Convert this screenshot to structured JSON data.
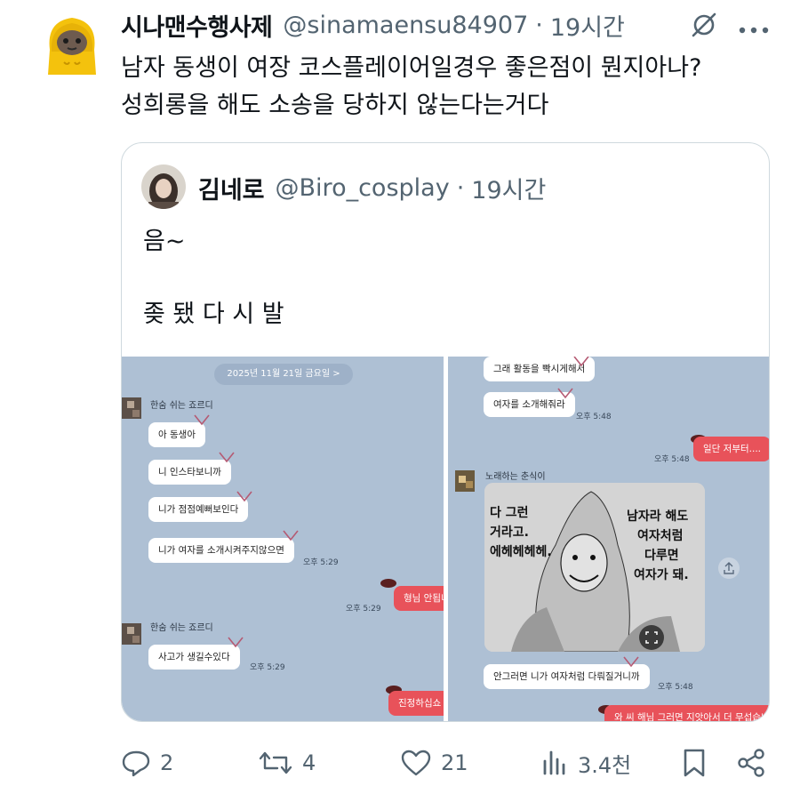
{
  "tweet": {
    "author_name": "시나맨수행사제",
    "author_handle": "@sinamaensu84907",
    "separator": "·",
    "time": "19시간",
    "text_line1": "남자 동생이 여장 코스플레이어일경우 좋은점이 뭔지아나?",
    "text_line2": "성희롱을 해도 소송을 당하지 않는다는거다"
  },
  "quote": {
    "author_name": "김네로",
    "author_handle": "@Biro_cosplay",
    "separator": "·",
    "time": "19시간",
    "text_line1": "음~",
    "text_line2": "좆 됐 다 시 발"
  },
  "chat_left": {
    "date": "2025년 11월 21일 금요일 >",
    "sender1": "한숨 쉬는 죠르디",
    "msgs1": [
      "아 동생아",
      "니 인스타보니까",
      "니가 점점예뻐보인다",
      "니가 여자를 소개시켜주지않으면"
    ],
    "time1": "오후 5:29",
    "reply1": "형님 안됩니다",
    "time2": "오후 5:29",
    "sender2": "한숨 쉬는 죠르디",
    "msg2": "사고가 생길수있다",
    "time3": "오후 5:29",
    "reply2": "진정하십쇼"
  },
  "chat_right": {
    "msg_top": "그래 활동을 빡시게해서",
    "msg2": "여자를 소개해줘라",
    "time1": "오후 5:48",
    "reply1": "일단 저부터....",
    "time2": "오후 5:48",
    "sender": "노래하는 춘식이",
    "comic_left_1": "다 그런",
    "comic_left_2": "거라고.",
    "comic_left_3": "에헤헤헤헤.",
    "comic_right_1": "남자라 해도",
    "comic_right_2": "여자처럼",
    "comic_right_3": "다루면",
    "comic_right_4": "여자가 돼.",
    "msg3": "안그러면 니가 여자처럼 다뤄질거니까",
    "time3": "오후 5:48",
    "reply_cut": "와 씨 해님 그러면 지앗아서 더 무섭습니다"
  },
  "actions": {
    "replies": "2",
    "retweets": "4",
    "likes": "21",
    "views": "3.4천"
  },
  "icons": [
    "grok-icon",
    "more-icon",
    "reply-icon",
    "retweet-icon",
    "like-icon",
    "views-icon",
    "bookmark-icon",
    "share-icon"
  ],
  "colors": {
    "text": "#0f1419",
    "muted": "#536471",
    "border": "#cfd9de",
    "chat_bg": "#aec0d4",
    "my_bubble": "#e8525a"
  }
}
